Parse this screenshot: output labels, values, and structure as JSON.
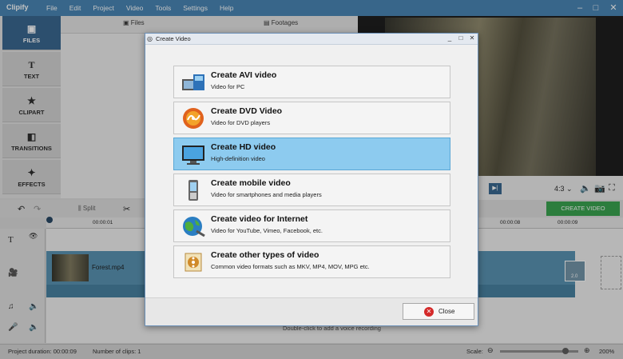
{
  "app": {
    "title": "Clipify",
    "menu": [
      "File",
      "Edit",
      "Project",
      "Video",
      "Tools",
      "Settings",
      "Help"
    ]
  },
  "sidebar": {
    "items": [
      {
        "label": "FILES",
        "icon": "image-icon"
      },
      {
        "label": "TEXT",
        "icon": "text-icon"
      },
      {
        "label": "CLIPART",
        "icon": "star-icon"
      },
      {
        "label": "TRANSITIONS",
        "icon": "transitions-icon"
      },
      {
        "label": "EFFECTS",
        "icon": "magic-wand-icon"
      }
    ]
  },
  "tabs": {
    "files": "Files",
    "footages": "Footages"
  },
  "player": {
    "aspect": "4:3",
    "create_label": "CREATE VIDEO"
  },
  "toolbar": {
    "split_label": "Split"
  },
  "timeline": {
    "ticks": [
      "00:00:01",
      "00:00:08",
      "00:00:09"
    ],
    "clip_name": "Forest.mp4",
    "transition_value": "2.0",
    "voice_hint": "Double-click to add a voice recording"
  },
  "status": {
    "duration": "Project duration:  00:00:09",
    "clips": "Number of clips: 1",
    "scale_label": "Scale:",
    "zoom": "200%"
  },
  "dialog": {
    "title": "Create Video",
    "options": [
      {
        "title": "Create AVI video",
        "subtitle": "Video for PC",
        "icon": "avi-film-icon"
      },
      {
        "title": "Create DVD Video",
        "subtitle": "Video for DVD players",
        "icon": "dvd-disc-icon"
      },
      {
        "title": "Create HD video",
        "subtitle": "High-definition video",
        "icon": "hd-monitor-icon"
      },
      {
        "title": "Create mobile video",
        "subtitle": "Video for smartphones and media players",
        "icon": "mobile-phone-icon"
      },
      {
        "title": "Create video for Internet",
        "subtitle": "Video for YouTube, Vimeo, Facebook, etc.",
        "icon": "globe-icon"
      },
      {
        "title": "Create other types of video",
        "subtitle": "Common video formats such as MKV, MP4, MOV, MPG etc.",
        "icon": "film-reel-icon"
      }
    ],
    "close_label": "Close",
    "selected_index": 2
  }
}
